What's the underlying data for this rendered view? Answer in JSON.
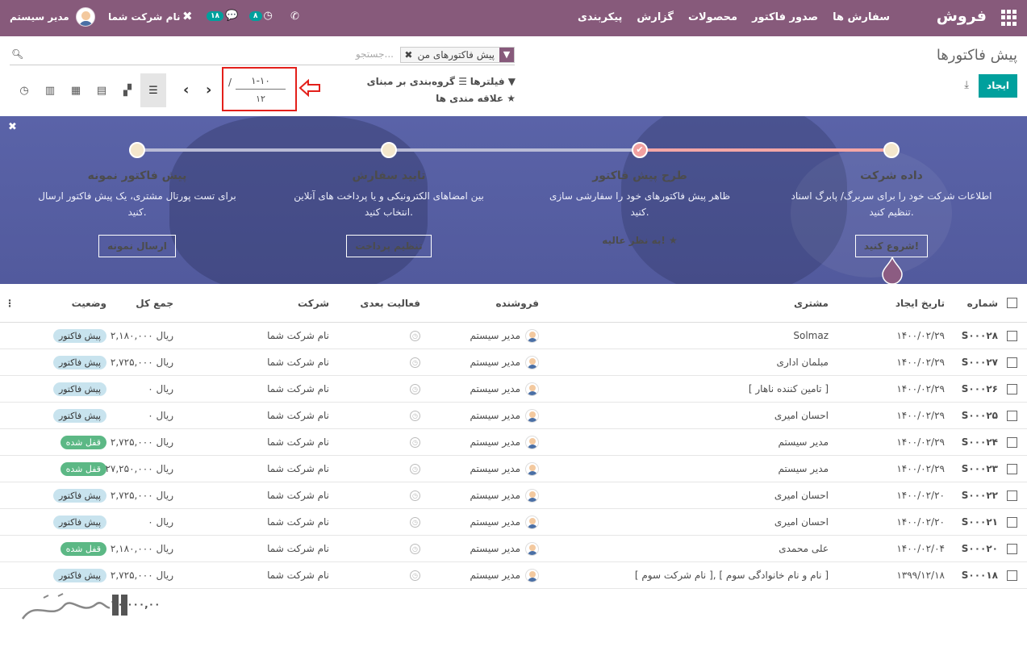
{
  "navbar": {
    "brand": "فروش",
    "menu": [
      "سفارش ها",
      "صدور فاکتور",
      "محصولات",
      "گزارش",
      "پیکربندی"
    ],
    "user_name": "مدیر سیستم",
    "company": "نام شرکت شما",
    "messages_count": "۱۸",
    "activities_count": "۸",
    "color": "#875a7b"
  },
  "control": {
    "title": "پیش فاکتورها",
    "search_placeholder": "جستجو...",
    "facet_label": "پیش فاکتورهای من",
    "create_label": "ایجاد",
    "filters_label": "فیلترها",
    "groupby_label": "گروه‌بندی بر مبنای",
    "favorites_label": "علاقه مندی ها",
    "pager_value": "۱-۱۰",
    "pager_sep": "/",
    "pager_total": "۱۲"
  },
  "banner": {
    "steps": [
      {
        "title": "داده شرکت",
        "desc": "اطلاعات شرکت خود را برای سربرگ/ پابرگ اسناد تنظیم کنید.",
        "button": "شروع کنید!"
      },
      {
        "title": "طرح پیش فاکتور",
        "desc": "ظاهر پیش فاکتورهای خود را سفارشی سازی کنید.",
        "done": "به نظر عالیه!"
      },
      {
        "title": "تایید سفارش",
        "desc": "بین امضاهای الکترونیکی و یا پرداخت های آنلاین انتخاب کنید.",
        "button": "تنظیم پرداخت"
      },
      {
        "title": "پیش فاکتور نمونه",
        "desc": "برای تست پورتال مشتری، یک پیش فاکتور ارسال کنید.",
        "button": "ارسال نمونه"
      }
    ]
  },
  "table": {
    "headers": {
      "number": "شماره",
      "date": "تاریخ ایجاد",
      "customer": "مشتری",
      "salesperson": "فروشنده",
      "activity": "فعالیت بعدی",
      "company": "شرکت",
      "total": "جمع کل",
      "state": "وضعیت"
    },
    "rows": [
      {
        "number": "S۰۰۰۲۸",
        "date": "۱۴۰۰/۰۲/۲۹",
        "customer": "Solmaz",
        "salesperson": "مدیر سیستم",
        "company": "نام شرکت شما",
        "total": "۲,۱۸۰,۰۰۰ ریال",
        "state": "پیش فاکتور",
        "state_kind": "quote"
      },
      {
        "number": "S۰۰۰۲۷",
        "date": "۱۴۰۰/۰۲/۲۹",
        "customer": "مبلمان اداری",
        "salesperson": "مدیر سیستم",
        "company": "نام شرکت شما",
        "total": "۲,۷۲۵,۰۰۰ ریال",
        "state": "پیش فاکتور",
        "state_kind": "quote"
      },
      {
        "number": "S۰۰۰۲۶",
        "date": "۱۴۰۰/۰۲/۲۹",
        "customer": "[ تامین کننده ناهار ]",
        "salesperson": "مدیر سیستم",
        "company": "نام شرکت شما",
        "total": "۰ ریال",
        "state": "پیش فاکتور",
        "state_kind": "quote"
      },
      {
        "number": "S۰۰۰۲۵",
        "date": "۱۴۰۰/۰۲/۲۹",
        "customer": "احسان امیری",
        "salesperson": "مدیر سیستم",
        "company": "نام شرکت شما",
        "total": "۰ ریال",
        "state": "پیش فاکتور",
        "state_kind": "quote"
      },
      {
        "number": "S۰۰۰۲۴",
        "date": "۱۴۰۰/۰۲/۲۹",
        "customer": "مدیر سیستم",
        "salesperson": "مدیر سیستم",
        "company": "نام شرکت شما",
        "total": "۲,۷۲۵,۰۰۰ ریال",
        "state": "قفل شده",
        "state_kind": "locked"
      },
      {
        "number": "S۰۰۰۲۳",
        "date": "۱۴۰۰/۰۲/۲۹",
        "customer": "مدیر سیستم",
        "salesperson": "مدیر سیستم",
        "company": "نام شرکت شما",
        "total": "۲۷,۲۵۰,۰۰۰ ریال",
        "state": "قفل شده",
        "state_kind": "locked"
      },
      {
        "number": "S۰۰۰۲۲",
        "date": "۱۴۰۰/۰۲/۲۰",
        "customer": "احسان امیری",
        "salesperson": "مدیر سیستم",
        "company": "نام شرکت شما",
        "total": "۲,۷۲۵,۰۰۰ ریال",
        "state": "پیش فاکتور",
        "state_kind": "quote"
      },
      {
        "number": "S۰۰۰۲۱",
        "date": "۱۴۰۰/۰۲/۲۰",
        "customer": "احسان امیری",
        "salesperson": "مدیر سیستم",
        "company": "نام شرکت شما",
        "total": "۰ ریال",
        "state": "پیش فاکتور",
        "state_kind": "quote"
      },
      {
        "number": "S۰۰۰۲۰",
        "date": "۱۴۰۰/۰۲/۰۴",
        "customer": "علی محمدی",
        "salesperson": "مدیر سیستم",
        "company": "نام شرکت شما",
        "total": "۲,۱۸۰,۰۰۰ ریال",
        "state": "قفل شده",
        "state_kind": "locked"
      },
      {
        "number": "S۰۰۰۱۸",
        "date": "۱۳۹۹/۱۲/۱۸",
        "customer": "[ نام شرکت سوم ], [ نام و نام خانوادگی سوم ]",
        "salesperson": "مدیر سیستم",
        "company": "نام شرکت شما",
        "total": "۲,۷۲۵,۰۰۰ ریال",
        "state": "پیش فاکتور",
        "state_kind": "quote"
      }
    ],
    "footer_total": "۴۰,۰۰۰,۰۰"
  }
}
